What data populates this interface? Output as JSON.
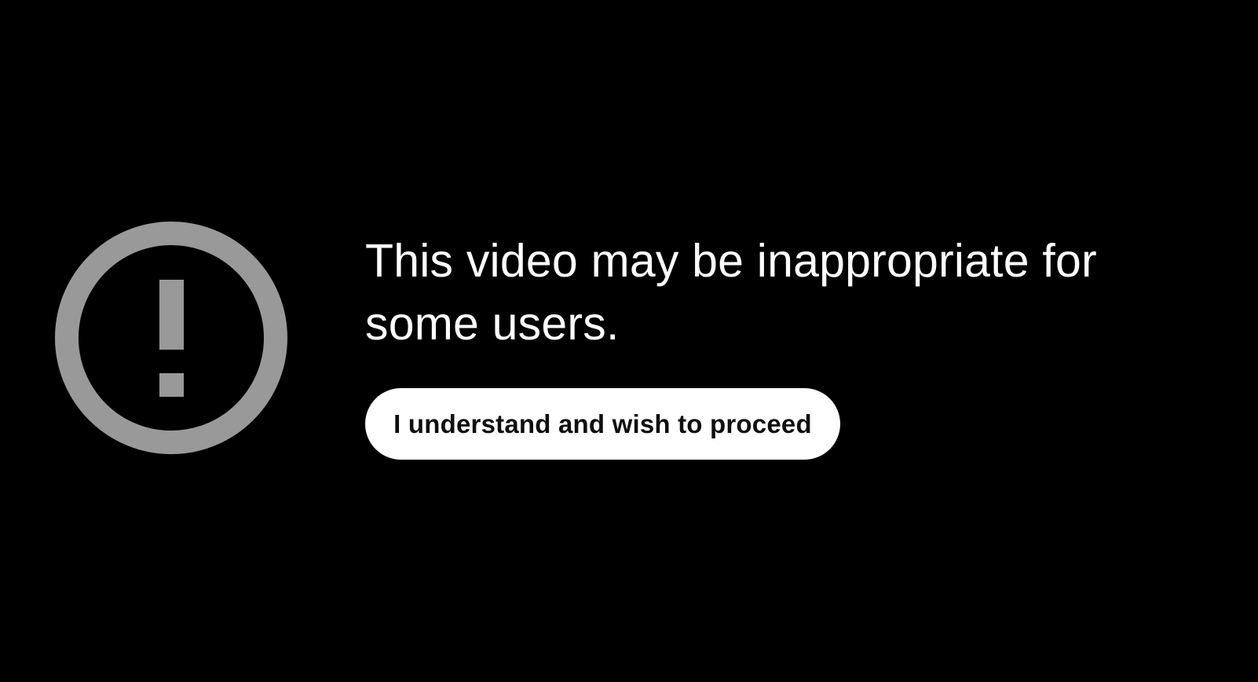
{
  "warning": {
    "icon": "exclamation-circle-icon",
    "icon_color": "#999999",
    "message": "This video may be inappropriate for some users.",
    "proceed_label": "I understand and wish to proceed"
  },
  "colors": {
    "background": "#000000",
    "text": "#ffffff",
    "button_bg": "#ffffff",
    "button_text": "#0f0f0f"
  }
}
